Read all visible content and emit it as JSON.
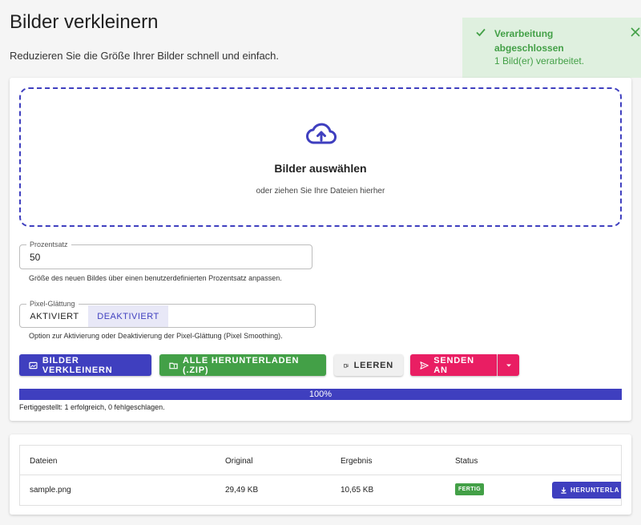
{
  "header": {
    "title": "Bilder verkleinern",
    "subtitle": "Reduzieren Sie die Größe Ihrer Bilder schnell und einfach."
  },
  "toast": {
    "title": "Verarbeitung abgeschlossen",
    "message": "1 Bild(er) verarbeitet.",
    "color": "#43a047",
    "background": "#dff0df"
  },
  "dropzone": {
    "icon": "cloud-upload-icon",
    "title": "Bilder auswählen",
    "subtitle": "oder ziehen Sie Ihre Dateien hierher"
  },
  "percent": {
    "label": "Prozentsatz",
    "value": "50",
    "hint": "Größe des neuen Bildes über einen benutzerdefinierten Prozentsatz anpassen."
  },
  "smoothing": {
    "label": "Pixel-Glättung",
    "options": [
      "AKTIVIERT",
      "DEAKTIVIERT"
    ],
    "selected": "DEAKTIVIERT",
    "hint": "Option zur Aktivierung oder Deaktivierung der Pixel-Glättung (Pixel Smoothing)."
  },
  "actions": {
    "shrink": "BILDER VERKLEINERN",
    "download_zip": "ALLE HERUNTERLADEN (.ZIP)",
    "clear": "LEEREN",
    "send": "SENDEN AN"
  },
  "progress": {
    "value": 100,
    "label": "100%",
    "status": "Fertiggestellt: 1 erfolgreich, 0 fehlgeschlagen."
  },
  "table": {
    "columns": [
      "Dateien",
      "Original",
      "Ergebnis",
      "Status"
    ],
    "rows": [
      {
        "file": "sample.png",
        "original": "29,49 KB",
        "result": "10,65 KB",
        "status": "FERTIG",
        "action": "HERUNTERLA"
      }
    ]
  },
  "colors": {
    "primary": "#3f3fbf",
    "success": "#43a047",
    "accent": "#e91e63"
  }
}
